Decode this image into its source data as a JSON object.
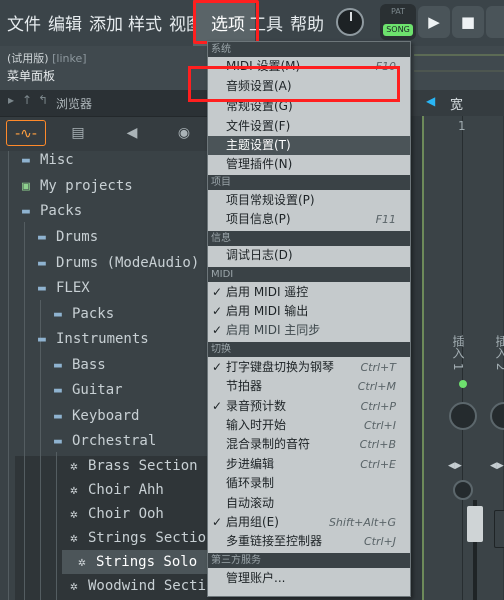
{
  "menubar": {
    "items": [
      "文件",
      "编辑",
      "添加",
      "样式",
      "视图",
      "选项",
      "工具",
      "帮助"
    ],
    "pat_label": "PAT",
    "song_label": "SONG",
    "play_icon": "play-icon",
    "stop_icon": "stop-icon"
  },
  "secondary_bar": {
    "trial": "(试用版)",
    "user": "[linke]",
    "title": "菜单面板"
  },
  "browser": {
    "header": "浏览器",
    "tree": [
      {
        "label": "Misc",
        "icon": "folder-icon"
      },
      {
        "label": "My projects",
        "icon": "folder-icon"
      },
      {
        "label": "Packs",
        "icon": "folder-icon"
      },
      {
        "label": "Drums",
        "icon": "folder-icon"
      },
      {
        "label": "Drums (ModeAudio)",
        "icon": "folder-icon"
      },
      {
        "label": "FLEX",
        "icon": "folder-icon"
      },
      {
        "label": "Packs",
        "icon": "folder-icon"
      },
      {
        "label": "Instruments",
        "icon": "folder-icon"
      },
      {
        "label": "Bass",
        "icon": "folder-icon"
      },
      {
        "label": "Guitar",
        "icon": "folder-icon"
      },
      {
        "label": "Keyboard",
        "icon": "folder-icon"
      },
      {
        "label": "Orchestral",
        "icon": "folder-icon"
      },
      {
        "label": "Brass Section",
        "icon": "gear-icon"
      },
      {
        "label": "Choir Ahh",
        "icon": "gear-icon"
      },
      {
        "label": "Choir Ooh",
        "icon": "gear-icon"
      },
      {
        "label": "Strings Section",
        "icon": "gear-icon"
      },
      {
        "label": "Strings Solo",
        "icon": "gear-icon"
      },
      {
        "label": "Woodwind Section",
        "icon": "gear-icon"
      }
    ]
  },
  "mixer": {
    "wide_label": "宽",
    "strip_number": "1",
    "insert_1": "插入 1",
    "insert_2": "插入 2"
  },
  "dropdown": {
    "sections": {
      "system": "系统",
      "project": "项目",
      "info": "信息",
      "midi": "MIDI",
      "toggle": "切换",
      "third_party": "第三方服务"
    },
    "system_items": [
      {
        "label": "MIDI 设置(M)",
        "shortcut": "F10"
      },
      {
        "label": "音频设置(A)",
        "shortcut": ""
      },
      {
        "label": "常规设置(G)",
        "shortcut": ""
      },
      {
        "label": "文件设置(F)",
        "shortcut": ""
      },
      {
        "label": "主题设置(T)",
        "shortcut": ""
      },
      {
        "label": "管理插件(N)",
        "shortcut": ""
      }
    ],
    "project_items": [
      {
        "label": "项目常规设置(P)",
        "shortcut": ""
      },
      {
        "label": "项目信息(P)",
        "shortcut": "F11"
      }
    ],
    "info_items": [
      {
        "label": "调试日志(D)",
        "shortcut": ""
      }
    ],
    "midi_items": [
      {
        "label": "启用 MIDI 遥控",
        "checked": true
      },
      {
        "label": "启用 MIDI 输出",
        "checked": true
      },
      {
        "label": "启用 MIDI 主同步",
        "checked": true
      }
    ],
    "toggle_items": [
      {
        "label": "打字键盘切换为钢琴",
        "shortcut": "Ctrl+T",
        "checked": true
      },
      {
        "label": "节拍器",
        "shortcut": "Ctrl+M",
        "checked": false
      },
      {
        "label": "录音预计数",
        "shortcut": "Ctrl+P",
        "checked": true
      },
      {
        "label": "输入时开始",
        "shortcut": "Ctrl+I",
        "checked": false
      },
      {
        "label": "混合录制的音符",
        "shortcut": "Ctrl+B",
        "checked": false
      },
      {
        "label": "步进编辑",
        "shortcut": "Ctrl+E",
        "checked": false
      },
      {
        "label": "循环录制",
        "shortcut": "",
        "checked": false
      },
      {
        "label": "自动滚动",
        "shortcut": "",
        "checked": false
      },
      {
        "label": "启用组(E)",
        "shortcut": "Shift+Alt+G",
        "checked": true
      },
      {
        "label": "多重链接至控制器",
        "shortcut": "Ctrl+J",
        "checked": false
      }
    ],
    "third_party_items": [
      {
        "label": "管理账户...",
        "shortcut": ""
      }
    ]
  }
}
